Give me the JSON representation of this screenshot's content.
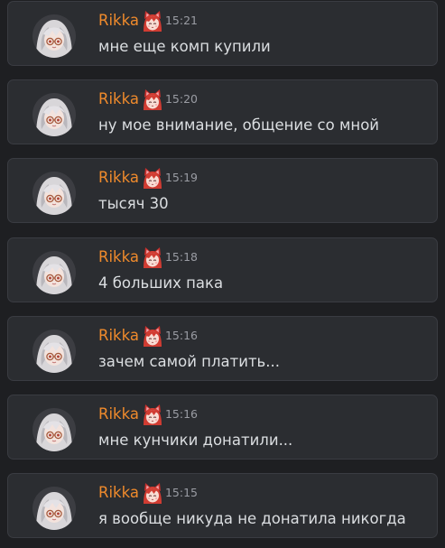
{
  "messages": [
    {
      "author": "Rikka",
      "time": "15:21",
      "text": "мне еще комп купили"
    },
    {
      "author": "Rikka",
      "time": "15:20",
      "text": "ну мое внимание, общение со мной"
    },
    {
      "author": "Rikka",
      "time": "15:19",
      "text": "тысяч 30"
    },
    {
      "author": "Rikka",
      "time": "15:18",
      "text": "4 больших пака"
    },
    {
      "author": "Rikka",
      "time": "15:16",
      "text": "зачем самой платить..."
    },
    {
      "author": "Rikka",
      "time": "15:16",
      "text": "мне кунчики донатили..."
    },
    {
      "author": "Rikka",
      "time": "15:15",
      "text": "я вообще никуда не донатила никогда"
    }
  ],
  "colors": {
    "background": "#1e1f22",
    "card": "#2b2d31",
    "username": "#ef8a2c",
    "timestamp": "#9a9ca3",
    "text": "#dbdee1"
  },
  "icons": {
    "avatar": "anime-girl-avatar",
    "badge": "fox-girl-emoji-badge"
  }
}
